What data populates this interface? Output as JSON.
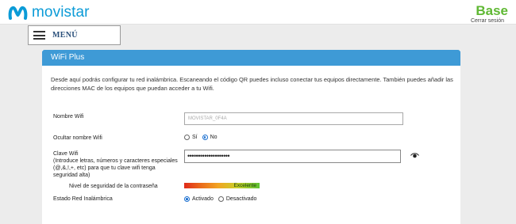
{
  "header": {
    "brand": "movistar",
    "plan": "Base",
    "logout": "Cerrar sesión"
  },
  "menu": {
    "label": "MENÚ"
  },
  "panel": {
    "title": "WiFi Plus",
    "intro": "Desde aquí podrás configurar tu red inalámbrica. Escaneando el código QR puedes incluso conectar tus equipos directamente. También puedes añadir las direcciones MAC de los equipos que puedan acceder a tu Wifi."
  },
  "form": {
    "wifi_name_label": "Nombre Wifi",
    "wifi_name_value": "MOVISTAR_0F4A",
    "hide_name_label": "Ocultar nombre Wifi",
    "hide_options": {
      "yes": "Sí",
      "no": "No"
    },
    "hide_selected": "No",
    "password_label": "Clave Wifi",
    "password_hint": "(Introduce letras, números y caracteres especiales (@,&,!,+, etc) para que tu clave wifi tenga seguridad alta)",
    "password_value": "••••••••••••••••••••",
    "strength_label": "Nivel de seguridad de la contraseña",
    "strength_text": "Excelente",
    "strength_level": 1.0,
    "network_state_label": "Estado Red Inalámbrica",
    "network_options": {
      "on": "Activado",
      "off": "Desactivado"
    },
    "network_selected": "Activado"
  },
  "icons": {
    "logo": "movistar-m-logo",
    "menu": "hamburger-icon",
    "eye": "eye-icon"
  },
  "colors": {
    "brand": "#0b9bd7",
    "plan": "#5fb833",
    "panel_header": "#3e9ad6",
    "menu_text": "#2a4f7a"
  }
}
